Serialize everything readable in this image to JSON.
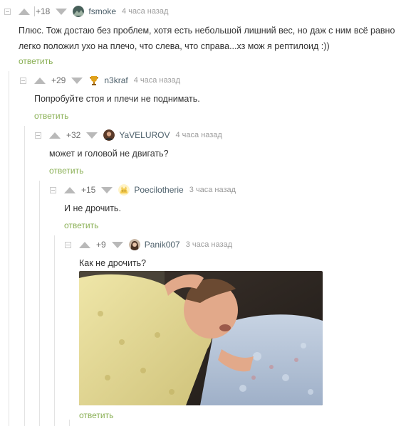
{
  "comments": [
    {
      "rating": "+18",
      "nick": "fsmoke",
      "time": "4 часа назад",
      "text_lines": [
        "Плюс. Тож достаю без проблем, хотя есть небольшой лишний вес, но даж с ним всё равно",
        "легко положил ухо на плечо, что слева, что справа...хз мож я рептилоид :))"
      ],
      "reply": "ответить",
      "avatar_icon": "landscape-avatar-icon"
    },
    {
      "rating": "+29",
      "nick": "n3kraf",
      "time": "4 часа назад",
      "text_lines": [
        "Попробуйте стоя и плечи не поднимать."
      ],
      "reply": "ответить",
      "avatar_icon": "trophy-icon"
    },
    {
      "rating": "+32",
      "nick": "YaVELUROV",
      "time": "4 часа назад",
      "text_lines": [
        "может и головой не двигать?"
      ],
      "reply": "ответить",
      "avatar_icon": "person-avatar-icon"
    },
    {
      "rating": "+15",
      "nick": "Poecilotherie",
      "time": "3 часа назад",
      "text_lines": [
        "И не дрочить."
      ],
      "reply": "ответить",
      "avatar_icon": "cat-avatar-icon"
    },
    {
      "rating": "+9",
      "nick": "Panik007",
      "time": "3 часа назад",
      "text_lines": [
        "Как не дрочить?"
      ],
      "reply": "ответить",
      "avatar_icon": "girl-avatar-icon"
    }
  ],
  "colors": {
    "reply": "#8ab055",
    "nick": "#4c5f6a",
    "time": "#9b9b9b",
    "arrow": "#b9b9b9"
  }
}
